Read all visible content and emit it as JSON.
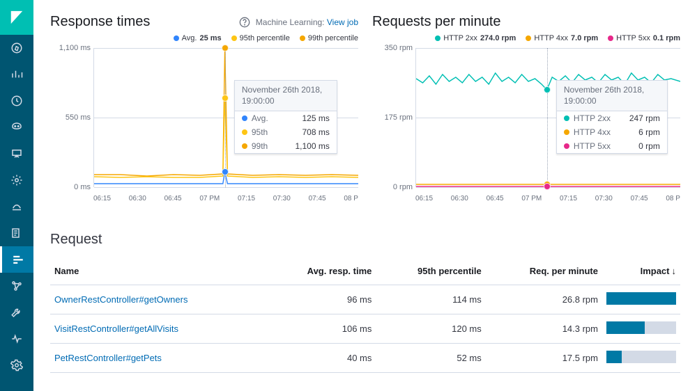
{
  "sidebar": {
    "items": [
      "compass",
      "bar-chart",
      "clock",
      "mask",
      "presentation",
      "gear",
      "cloud",
      "building-list",
      "lines-menu",
      "graph",
      "wrench",
      "heartbeat",
      "settings"
    ]
  },
  "chart1": {
    "title": "Response times",
    "ml_label": "Machine Learning:",
    "ml_link": "View job",
    "legend": [
      {
        "color": "#3185fc",
        "label": "Avg.",
        "value": "25 ms"
      },
      {
        "color": "#fec514",
        "label": "95th percentile",
        "value": ""
      },
      {
        "color": "#f5a700",
        "label": "99th percentile",
        "value": ""
      }
    ],
    "y_ticks": [
      "1,100 ms",
      "550 ms",
      "0 ms"
    ],
    "x_ticks": [
      "06:15",
      "06:30",
      "06:45",
      "07 PM",
      "07:15",
      "07:30",
      "07:45",
      "08 P"
    ],
    "tooltip": {
      "header": "November 26th 2018, 19:00:00",
      "rows": [
        {
          "color": "#3185fc",
          "label": "Avg.",
          "value": "125 ms"
        },
        {
          "color": "#fec514",
          "label": "95th",
          "value": "708 ms"
        },
        {
          "color": "#f5a700",
          "label": "99th",
          "value": "1,100 ms"
        }
      ]
    }
  },
  "chart2": {
    "title": "Requests per minute",
    "legend": [
      {
        "color": "#00bfb3",
        "label": "HTTP 2xx",
        "value": "274.0 rpm"
      },
      {
        "color": "#f5a700",
        "label": "HTTP 4xx",
        "value": "7.0 rpm"
      },
      {
        "color": "#e7298a",
        "label": "HTTP 5xx",
        "value": "0.1 rpm"
      }
    ],
    "y_ticks": [
      "350 rpm",
      "175 rpm",
      "0 rpm"
    ],
    "x_ticks": [
      "06:15",
      "06:30",
      "06:45",
      "07 PM",
      "07:15",
      "07:30",
      "07:45",
      "08 P"
    ],
    "tooltip": {
      "header": "November 26th 2018, 19:00:00",
      "rows": [
        {
          "color": "#00bfb3",
          "label": "HTTP 2xx",
          "value": "247 rpm"
        },
        {
          "color": "#f5a700",
          "label": "HTTP 4xx",
          "value": "6 rpm"
        },
        {
          "color": "#e7298a",
          "label": "HTTP 5xx",
          "value": "0 rpm"
        }
      ]
    }
  },
  "chart_data": [
    {
      "type": "line",
      "title": "Response times",
      "xlabel": "",
      "ylabel": "ms",
      "ylim": [
        0,
        1100
      ],
      "categories": [
        "06:15",
        "06:30",
        "06:45",
        "07:00",
        "07:15",
        "07:30",
        "07:45",
        "08:00"
      ],
      "series": [
        {
          "name": "Avg.",
          "values": [
            25,
            25,
            25,
            125,
            25,
            25,
            25,
            25
          ]
        },
        {
          "name": "95th percentile",
          "values": [
            90,
            90,
            90,
            708,
            90,
            90,
            90,
            90
          ]
        },
        {
          "name": "99th percentile",
          "values": [
            100,
            95,
            100,
            1100,
            100,
            100,
            100,
            100
          ]
        }
      ]
    },
    {
      "type": "line",
      "title": "Requests per minute",
      "xlabel": "",
      "ylabel": "rpm",
      "ylim": [
        0,
        350
      ],
      "categories": [
        "06:15",
        "06:30",
        "06:45",
        "07:00",
        "07:15",
        "07:30",
        "07:45",
        "08:00"
      ],
      "series": [
        {
          "name": "HTTP 2xx",
          "values": [
            275,
            270,
            280,
            247,
            275,
            270,
            280,
            275
          ]
        },
        {
          "name": "HTTP 4xx",
          "values": [
            7,
            7,
            7,
            6,
            7,
            7,
            7,
            7
          ]
        },
        {
          "name": "HTTP 5xx",
          "values": [
            0,
            0,
            0,
            0,
            0,
            0,
            0,
            0
          ]
        }
      ]
    }
  ],
  "table": {
    "title": "Request",
    "columns": [
      "Name",
      "Avg. resp. time",
      "95th percentile",
      "Req. per minute",
      "Impact"
    ],
    "sort_column": "Impact",
    "rows": [
      {
        "name": "OwnerRestController#getOwners",
        "avg": "96 ms",
        "p95": "114 ms",
        "rpm": "26.8 rpm",
        "impact": 100
      },
      {
        "name": "VisitRestController#getAllVisits",
        "avg": "106 ms",
        "p95": "120 ms",
        "rpm": "14.3 rpm",
        "impact": 55
      },
      {
        "name": "PetRestController#getPets",
        "avg": "40 ms",
        "p95": "52 ms",
        "rpm": "17.5 rpm",
        "impact": 22
      }
    ]
  }
}
